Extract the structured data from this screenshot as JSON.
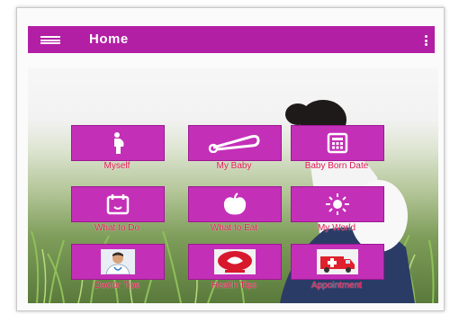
{
  "appbar": {
    "title": "Home",
    "menu_icon": "hamburger-menu-icon",
    "overflow_icon": "vertical-dots-icon",
    "background_color": "#b21fa4"
  },
  "tiles": [
    {
      "label": "Myself",
      "icon": "pregnant-woman-icon"
    },
    {
      "label": "My Baby",
      "icon": "safety-pin-icon"
    },
    {
      "label": "Baby Born Date",
      "icon": "calculator-icon"
    },
    {
      "label": "What to Do",
      "icon": "calendar-icon"
    },
    {
      "label": "What to Eat",
      "icon": "apple-icon"
    },
    {
      "label": "My World",
      "icon": "radiant-sun-icon"
    },
    {
      "label": "Doctor Tips",
      "icon": "doctor-icon"
    },
    {
      "label": "Health Tips",
      "icon": "health-logo-icon"
    },
    {
      "label": "Appointment",
      "icon": "ambulance-icon"
    }
  ],
  "colors": {
    "tile": "#c42fb8",
    "label": "#e0144e"
  }
}
